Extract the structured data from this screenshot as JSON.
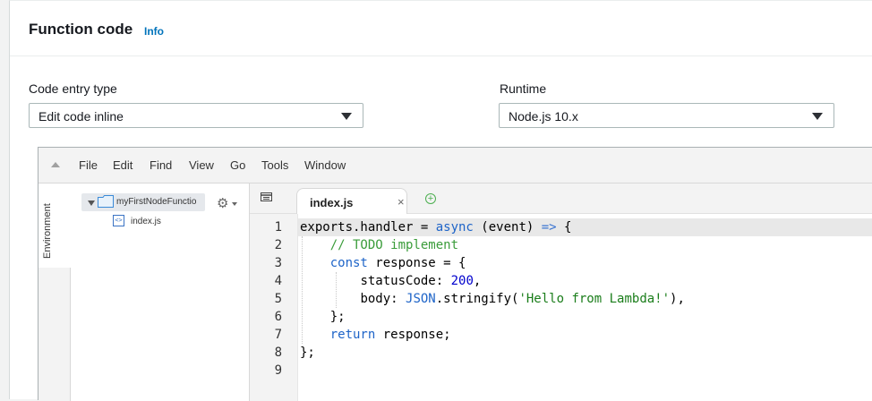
{
  "panel": {
    "title": "Function code",
    "info_label": "Info"
  },
  "code_entry_type": {
    "label": "Code entry type",
    "value": "Edit code inline"
  },
  "runtime": {
    "label": "Runtime",
    "value": "Node.js 10.x"
  },
  "ide": {
    "menu": [
      "File",
      "Edit",
      "Find",
      "View",
      "Go",
      "Tools",
      "Window"
    ],
    "side_tab": "Environment",
    "tree": {
      "folder": "myFirstNodeFunctio",
      "file": "index.js"
    },
    "editor_tab": {
      "label": "index.js",
      "close": "×",
      "add": "+"
    },
    "line_numbers": [
      "1",
      "2",
      "3",
      "4",
      "5",
      "6",
      "7",
      "8",
      "9"
    ],
    "code": {
      "l1": {
        "a": "exports.handler = ",
        "kw": "async",
        "b": " (event) ",
        "op": "=>",
        "c": " {"
      },
      "l2": {
        "comment": "// TODO implement"
      },
      "l3": {
        "kw": "const",
        "rest": " response = {"
      },
      "l4": {
        "key": "statusCode: ",
        "num": "200",
        "end": ","
      },
      "l5": {
        "key": "body: ",
        "obj": "JSON",
        "mid": ".stringify(",
        "str": "'Hello from Lambda!'",
        "end": "),"
      },
      "l6": {
        "text": "};"
      },
      "l7": {
        "kw": "return",
        "rest": " response;"
      },
      "l8": {
        "text": "};"
      }
    }
  },
  "colors": {
    "link": "#0073bb",
    "keyword": "#1e64c8",
    "comment": "#3a9c3a",
    "string": "#1a7d1a"
  }
}
